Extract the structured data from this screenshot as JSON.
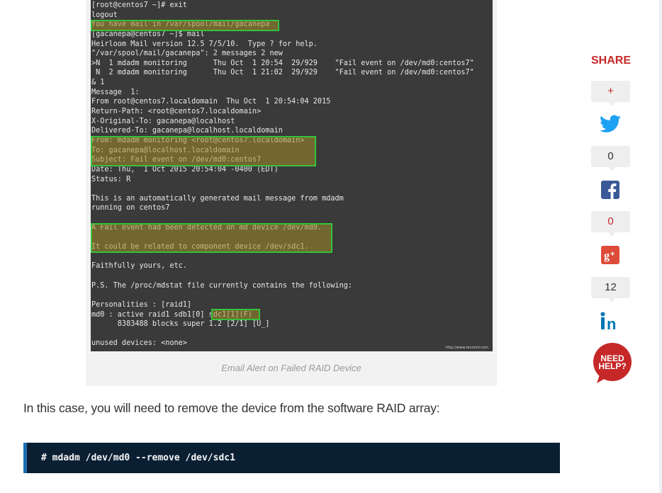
{
  "terminal": {
    "lines": [
      "[root@centos7 ~]# exit",
      "logout",
      "You have mail in /var/spool/mail/gacanepa",
      "[gacanepa@centos7 ~]$ mail",
      "Heirloom Mail version 12.5 7/5/10.  Type ? for help.",
      "\"/var/spool/mail/gacanepa\": 2 messages 2 new",
      ">N  1 mdadm monitoring      Thu Oct  1 20:54  29/929    \"Fail event on /dev/md0:centos7\"",
      " N  2 mdadm monitoring      Thu Oct  1 21:02  29/929    \"Fail event on /dev/md0:centos7\"",
      "& 1",
      "Message  1:",
      "From root@centos7.localdomain  Thu Oct  1 20:54:04 2015",
      "Return-Path: <root@centos7.localdomain>",
      "X-Original-To: gacanepa@localhost",
      "Delivered-To: gacanepa@localhost.localdomain",
      "From: mdadm monitoring <root@centos7.localdomain>",
      "To: gacanepa@localhost.localdomain",
      "Subject: Fail event on /dev/md0:centos7",
      "Date: Thu,  1 Oct 2015 20:54:04 -0400 (EDT)",
      "Status: R",
      "",
      "This is an automatically generated mail message from mdadm",
      "running on centos7",
      "",
      "A Fail event had been detected on md device /dev/md0.",
      "",
      "It could be related to component device /dev/sdc1.",
      "",
      "Faithfully yours, etc.",
      "",
      "P.S. The /proc/mdstat file currently contains the following:",
      "",
      "Personalities : [raid1]",
      "md0 : active raid1 sdb1[0] sdc1[1](F)",
      "      8383488 blocks super 1.2 [2/1] [U_]",
      "",
      "unused devices: <none>"
    ],
    "watermark": "http://www.tecmint.com"
  },
  "caption": "Email Alert on Failed RAID Device",
  "paragraph": "In this case, you will need to remove the device from the software RAID array:",
  "code": "# mdadm /dev/md0 --remove /dev/sdc1",
  "share": {
    "title": "SHARE",
    "plus_label": "+",
    "twitter_count": "0",
    "facebook_count": "0",
    "linkedin_count": "12",
    "need_help_line1": "NEED",
    "need_help_line2": "HELP?"
  },
  "colors": {
    "accent_red": "#c62828",
    "twitter": "#1da1f2",
    "facebook": "#3b5998",
    "googleplus": "#dd4b39",
    "linkedin": "#0077b5",
    "code_bg": "#0b1f33",
    "highlight_border": "#36c23a"
  }
}
